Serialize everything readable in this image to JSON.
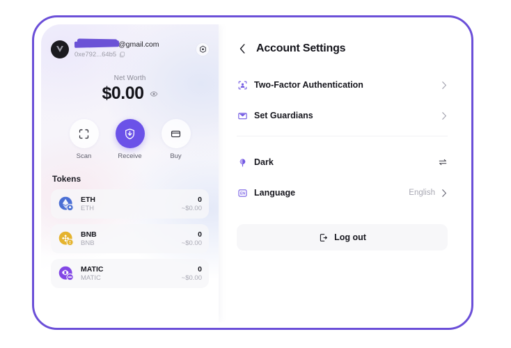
{
  "frame": {
    "accent_color": "#6b4fd8"
  },
  "wallet": {
    "account": {
      "email": "@gmail.com",
      "email_redacted": true,
      "address": "0xe792...64b5",
      "copy_icon": "copy-icon",
      "avatar_icon": "avatar-icon",
      "settings_icon": "gear-icon"
    },
    "net_worth": {
      "label": "Net Worth",
      "value": "$0.00",
      "visibility_icon": "eye-icon"
    },
    "actions": [
      {
        "label": "Scan",
        "icon": "scan-icon",
        "primary": false
      },
      {
        "label": "Receive",
        "icon": "receive-icon",
        "primary": true
      },
      {
        "label": "Buy",
        "icon": "card-icon",
        "primary": false
      }
    ],
    "tokens_title": "Tokens",
    "tokens": [
      {
        "symbol": "ETH",
        "name": "ETH",
        "amount": "0",
        "fiat": "~$0.00",
        "icon": "eth-icon",
        "color": "#4b6fd4"
      },
      {
        "symbol": "BNB",
        "name": "BNB",
        "amount": "0",
        "fiat": "~$0.00",
        "icon": "bnb-icon",
        "color": "#e8b párt"
      },
      {
        "symbol": "MATIC",
        "name": "MATIC",
        "amount": "0",
        "fiat": "~$0.00",
        "icon": "matic-icon",
        "color": "#8247e5"
      }
    ]
  },
  "settings": {
    "back_icon": "chevron-left-icon",
    "title": "Account Settings",
    "items": [
      {
        "label": "Two-Factor Authentication",
        "icon": "two-factor-icon",
        "value": "",
        "accessory": "chevron-right-icon"
      },
      {
        "label": "Set Guardians",
        "icon": "guardians-icon",
        "value": "",
        "accessory": "chevron-right-icon"
      },
      {
        "label": "Dark",
        "icon": "theme-icon",
        "value": "",
        "accessory": "toggle-swap-icon"
      },
      {
        "label": "Language",
        "icon": "language-icon",
        "value": "English",
        "accessory": "chevron-right-icon"
      }
    ],
    "logout": {
      "label": "Log out",
      "icon": "logout-icon"
    }
  }
}
